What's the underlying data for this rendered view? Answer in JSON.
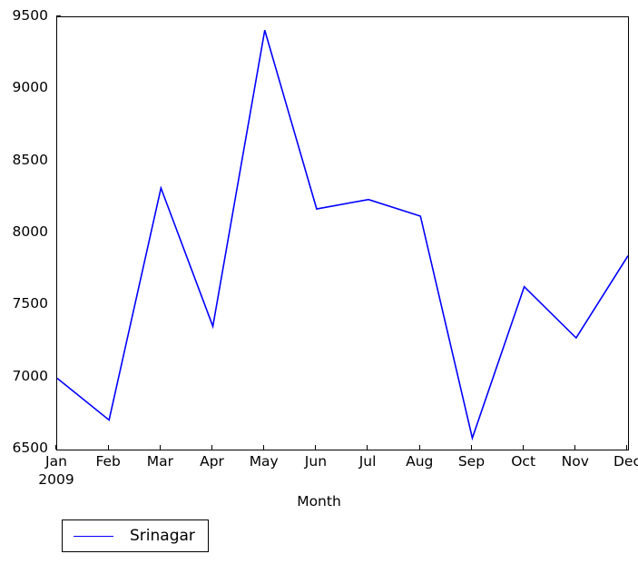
{
  "chart_data": {
    "type": "line",
    "title": "",
    "xlabel": "Month",
    "ylabel": "",
    "categories": [
      "Jan",
      "Feb",
      "Mar",
      "Apr",
      "May",
      "Jun",
      "Jul",
      "Aug",
      "Sep",
      "Oct",
      "Nov",
      "Dec"
    ],
    "x_year_label": "2009",
    "series": [
      {
        "name": "Srinagar",
        "color": "#0000ff",
        "values": [
          6995,
          6705,
          8315,
          7355,
          9410,
          8170,
          8235,
          8120,
          6580,
          7630,
          7275,
          7845
        ]
      }
    ],
    "ylim": [
      6500,
      9500
    ],
    "ytick_labels": [
      "6500",
      "7000",
      "7500",
      "8000",
      "8500",
      "9000",
      "9500"
    ],
    "ytick_values": [
      6500,
      7000,
      7500,
      8000,
      8500,
      9000,
      9500
    ],
    "grid": false,
    "legend_position": "below-left",
    "legend": [
      "Srinagar"
    ]
  },
  "axis": {
    "x_title": "Month",
    "year": "2009"
  }
}
